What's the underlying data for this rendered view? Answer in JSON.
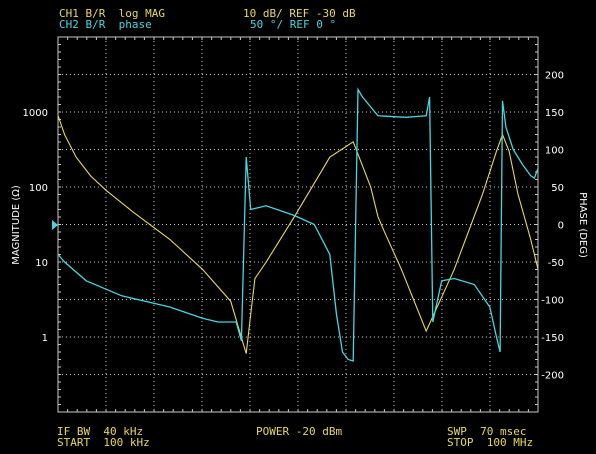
{
  "header": {
    "ch1_label": "CH1 B/R  log MAG",
    "ch1_scale": "10 dB/ REF -30 dB",
    "ch2_label": "CH2 B/R  phase",
    "ch2_scale": "50 °/ REF 0 °"
  },
  "footer": {
    "ifbw": "IF BW  40 kHz",
    "start": "START  100 kHz",
    "power": "POWER -20 dBm",
    "swp": "SWP  70 msec",
    "stop": "STOP  100 MHz"
  },
  "colors": {
    "ch1": "#e8d85a",
    "ch2": "#46d6e0",
    "grid": "#c8c8c8",
    "background": "#000000"
  },
  "marker_icon": "reference-triangle-icon",
  "chart_data": {
    "type": "line",
    "xlabel": "",
    "x_scale": "log",
    "x_range_hz": [
      100000,
      100000000
    ],
    "left_axis": {
      "label": "MAGNITUDE (Ω)",
      "scale": "log",
      "ticks": [
        "1000",
        "100",
        "10",
        "1"
      ],
      "tick_values": [
        1000,
        100,
        10,
        1
      ]
    },
    "right_axis": {
      "label": "PHASE (DEG)",
      "ticks": [
        "200",
        "150",
        "100",
        "50",
        "0",
        "-50",
        "-100",
        "-150",
        "-200"
      ],
      "tick_values": [
        200,
        150,
        100,
        50,
        0,
        -50,
        -100,
        -150,
        -200
      ],
      "range": [
        -250,
        250
      ]
    },
    "grid": true,
    "series": [
      {
        "channel": "CH1",
        "axis": "left",
        "x_hz": [
          100000,
          110000,
          130000,
          160000,
          200000,
          300000,
          500000,
          800000,
          1200000,
          1500000,
          1600000,
          1700000,
          2000000,
          3000000,
          5000000,
          7000000,
          9000000,
          10000000,
          11000000,
          14000000,
          20000000,
          30000000,
          45000000,
          55000000,
          60000000,
          66000000,
          75000000,
          90000000,
          100000000
        ],
        "values": [
          900,
          500,
          250,
          140,
          90,
          45,
          20,
          8,
          3,
          0.6,
          2,
          6,
          10,
          40,
          250,
          400,
          100,
          40,
          25,
          8,
          1.2,
          8,
          80,
          300,
          500,
          300,
          80,
          20,
          8
        ]
      },
      {
        "channel": "CH2",
        "axis": "right",
        "x_hz": [
          100000,
          110000,
          150000,
          250000,
          500000,
          800000,
          1000000,
          1200000,
          1300000,
          1400000,
          1500000,
          1600000,
          2000000,
          3000000,
          4000000,
          5000000,
          5500000,
          6000000,
          6500000,
          7000000,
          7500000,
          8000000,
          10000000,
          15000000,
          20000000,
          21000000,
          22000000,
          25000000,
          30000000,
          40000000,
          50000000,
          55000000,
          58000000,
          60000000,
          63000000,
          70000000,
          80000000,
          90000000,
          95000000,
          100000000
        ],
        "values": [
          -40,
          -50,
          -75,
          -95,
          -110,
          -125,
          -130,
          -130,
          -130,
          -155,
          90,
          20,
          25,
          12,
          0,
          -40,
          -120,
          -170,
          -180,
          -182,
          180,
          170,
          145,
          143,
          145,
          170,
          -130,
          -75,
          -72,
          -80,
          -110,
          -150,
          -170,
          165,
          130,
          100,
          80,
          65,
          62,
          75
        ]
      }
    ]
  }
}
